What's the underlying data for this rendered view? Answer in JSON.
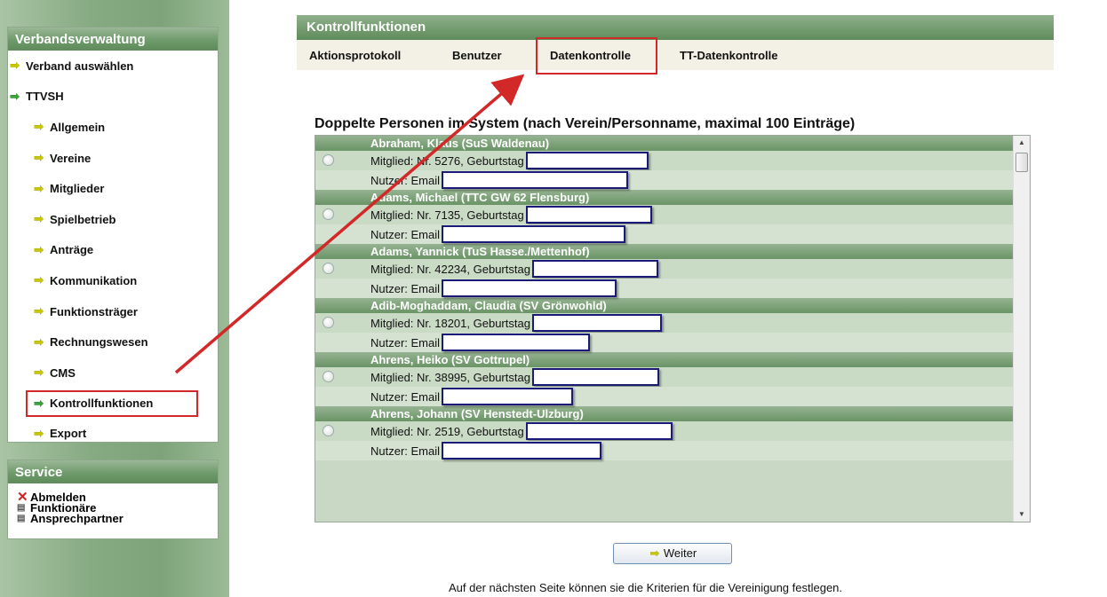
{
  "sidebar": {
    "title": "Verbandsverwaltung",
    "items": [
      {
        "label": "Verband auswählen",
        "level": "top"
      },
      {
        "label": "TTVSH",
        "level": "top-green"
      },
      {
        "label": "Allgemein"
      },
      {
        "label": "Vereine"
      },
      {
        "label": "Mitglieder"
      },
      {
        "label": "Spielbetrieb"
      },
      {
        "label": "Anträge"
      },
      {
        "label": "Kommunikation"
      },
      {
        "label": "Funktionsträger"
      },
      {
        "label": "Rechnungswesen"
      },
      {
        "label": "CMS"
      },
      {
        "label": "Kontrollfunktionen",
        "active": true
      },
      {
        "label": "Export"
      }
    ]
  },
  "service": {
    "title": "Service",
    "items": [
      {
        "label": "Abmelden",
        "icon": "close-icon"
      },
      {
        "label": "Funktionäre",
        "icon": "card-icon"
      },
      {
        "label": "Ansprechpartner",
        "icon": "card-icon"
      }
    ]
  },
  "main": {
    "title": "Kontrollfunktionen",
    "tabs": [
      {
        "label": "Aktionsprotokoll"
      },
      {
        "label": "Benutzer"
      },
      {
        "label": "Datenkontrolle",
        "active": true
      },
      {
        "label": "TT-Datenkontrolle"
      }
    ],
    "section_title": "Doppelte Personen im System (nach Verein/Personname, maximal 100 Einträge)",
    "groups": [
      {
        "name": "Abraham, Klaus (SuS Waldenau)",
        "member": "Mitglied: Nr. 5276, Geburtstag",
        "user": "Nutzer: Email"
      },
      {
        "name": "Adams, Michael (TTC GW 62 Flensburg)",
        "member": "Mitglied: Nr. 7135, Geburtstag",
        "user": "Nutzer: Email"
      },
      {
        "name": "Adams, Yannick (TuS Hasse./Mettenhof)",
        "member": "Mitglied: Nr. 42234, Geburtstag",
        "user": "Nutzer: Email"
      },
      {
        "name": "Adib-Moghaddam, Claudia (SV Grönwohld)",
        "member": "Mitglied: Nr. 18201, Geburtstag",
        "user": "Nutzer: Email"
      },
      {
        "name": "Ahrens, Heiko (SV Gottrupel)",
        "member": "Mitglied: Nr. 38995, Geburtstag",
        "user": "Nutzer: Email"
      },
      {
        "name": "Ahrens, Johann (SV Henstedt-Ulzburg)",
        "member": "Mitglied: Nr. 2519, Geburtstag",
        "user": "Nutzer: Email"
      }
    ],
    "button_label": "Weiter",
    "footer_text": "Auf der nächsten Seite können sie die Kriterien für die Vereinigung festlegen."
  },
  "colors": {
    "highlight": "#d32828",
    "header_green": "#6f9a6b",
    "redaction_border": "#1a1a78"
  }
}
